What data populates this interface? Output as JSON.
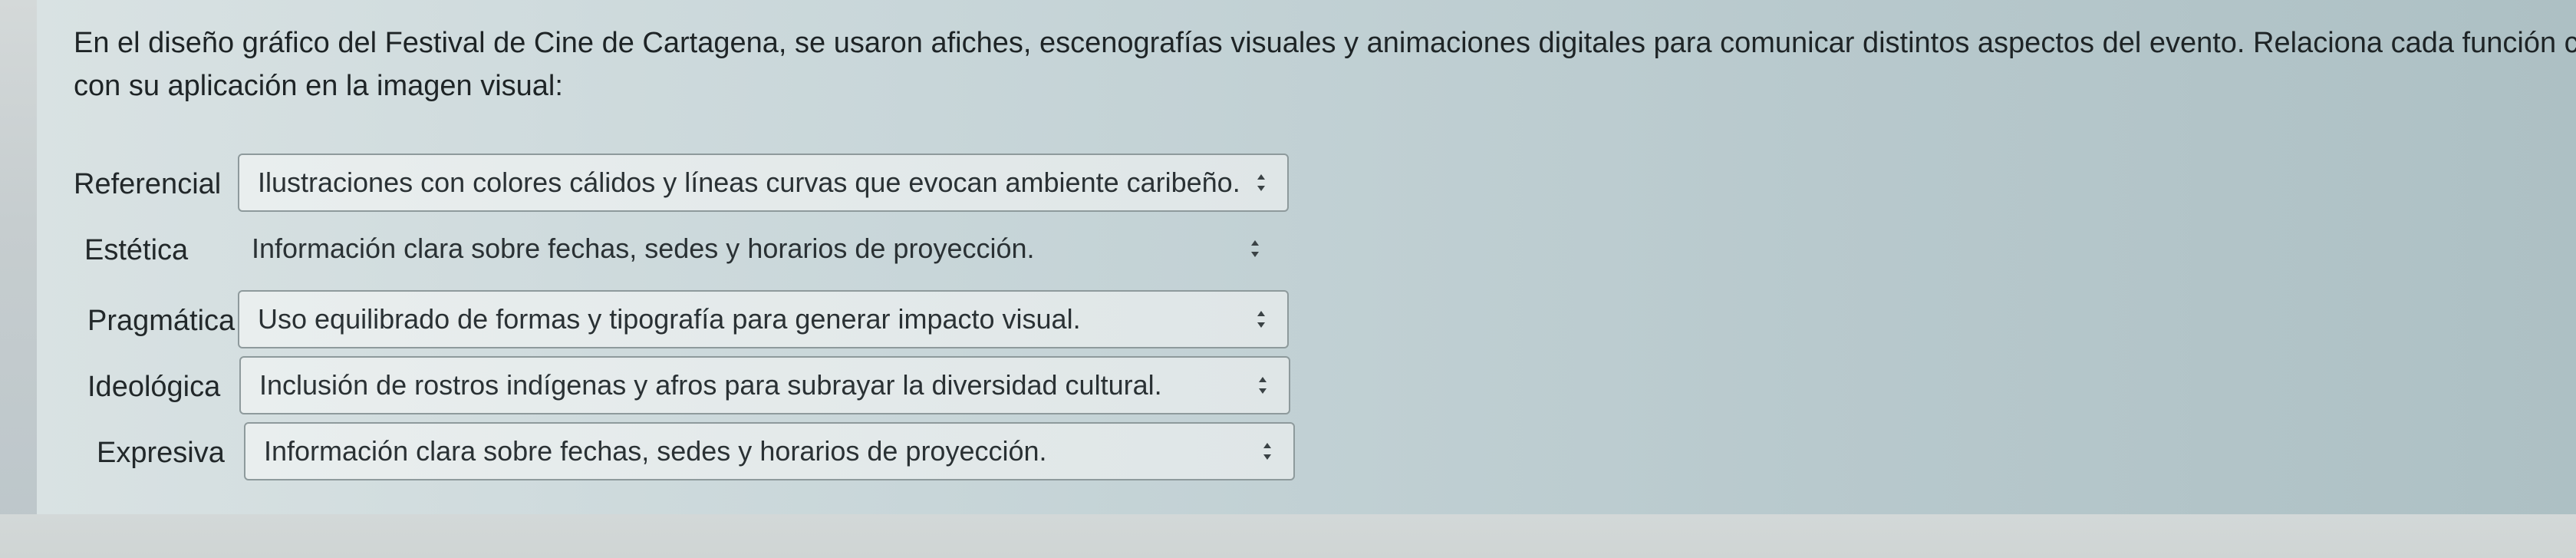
{
  "question": {
    "line1": "En el diseño gráfico del Festival de Cine de Cartagena, se usaron afiches, escenografías visuales y animaciones digitales para comunicar distintos aspectos del evento. Relaciona cada función comunicativa",
    "line2": "con su aplicación en la imagen visual:"
  },
  "matches": [
    {
      "label": "Referencial",
      "selected": "Ilustraciones con colores cálidos y líneas curvas que evocan ambiente caribeño."
    },
    {
      "label": "Estética",
      "selected": "Información clara sobre fechas, sedes y horarios de proyección."
    },
    {
      "label": "Pragmática",
      "selected": "Uso equilibrado de formas y tipografía para generar impacto visual."
    },
    {
      "label": "Ideológica",
      "selected": "Inclusión de rostros indígenas y afros para subrayar la diversidad cultural."
    },
    {
      "label": "Expresiva",
      "selected": "Información clara sobre fechas, sedes y horarios de proyección."
    }
  ],
  "icons": {
    "select_arrow": "sort-arrows-icon"
  }
}
